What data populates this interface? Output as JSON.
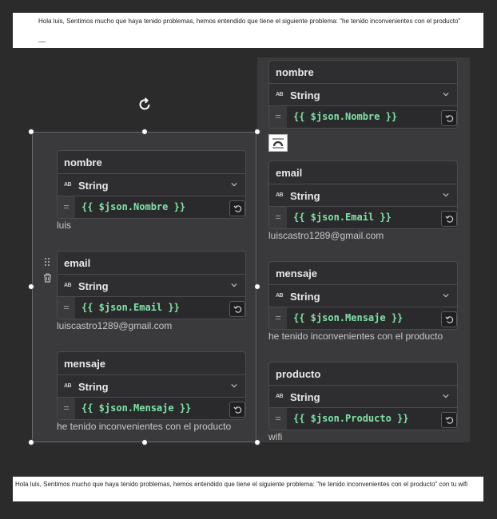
{
  "email_preview_top": {
    "line1": "Hola luis, Sentimos mucho que haya tenido problemas, hemos entendido que tiene el siguiente problema: \"he tenido inconvenientes con el producto\"",
    "line2": "__"
  },
  "email_preview_bottom": {
    "line1": "Hola luis, Sentimos mucho que haya tenido problemas, hemos entendido que tiene el siguiente problema: \"he tenido inconvenientes con el producto\" con tu wifi"
  },
  "left_fields": [
    {
      "name": "nombre",
      "type": "String",
      "type_badge": "AB",
      "eq": "=",
      "expression": "{{ $json.Nombre }}",
      "result": "luis"
    },
    {
      "name": "email",
      "type": "String",
      "type_badge": "AB",
      "eq": "=",
      "expression": "{{ $json.Email }}",
      "result": "luiscastro1289@gmail.com"
    },
    {
      "name": "mensaje",
      "type": "String",
      "type_badge": "AB",
      "eq": "=",
      "expression": "{{ $json.Mensaje }}",
      "result": "he tenido inconvenientes con el producto"
    }
  ],
  "right_fields": [
    {
      "name": "nombre",
      "type": "String",
      "type_badge": "AB",
      "eq": "=",
      "expression": "{{ $json.Nombre }}",
      "result": ""
    },
    {
      "name": "email",
      "type": "String",
      "type_badge": "AB",
      "eq": "=",
      "expression": "{{ $json.Email }}",
      "result": "luiscastro1289@gmail.com"
    },
    {
      "name": "mensaje",
      "type": "String",
      "type_badge": "AB",
      "eq": "=",
      "expression": "{{ $json.Mensaje }}",
      "result": "he tenido inconvenientes con el producto"
    },
    {
      "name": "producto",
      "type": "String",
      "type_badge": "AB",
      "eq": "=",
      "expression": "{{ $json.Producto }}",
      "result": "wifi"
    }
  ],
  "icons": {
    "rotate": "rotate-icon",
    "drag": "drag-handle-icon",
    "delete": "trash-icon",
    "dropdown": "chevron-down-icon",
    "reset": "reset-icon",
    "hover": "dots-icon"
  },
  "colors": {
    "background": "#2b2b2b",
    "panel": "#3a3a3c",
    "expression": "#7fe3a8"
  }
}
